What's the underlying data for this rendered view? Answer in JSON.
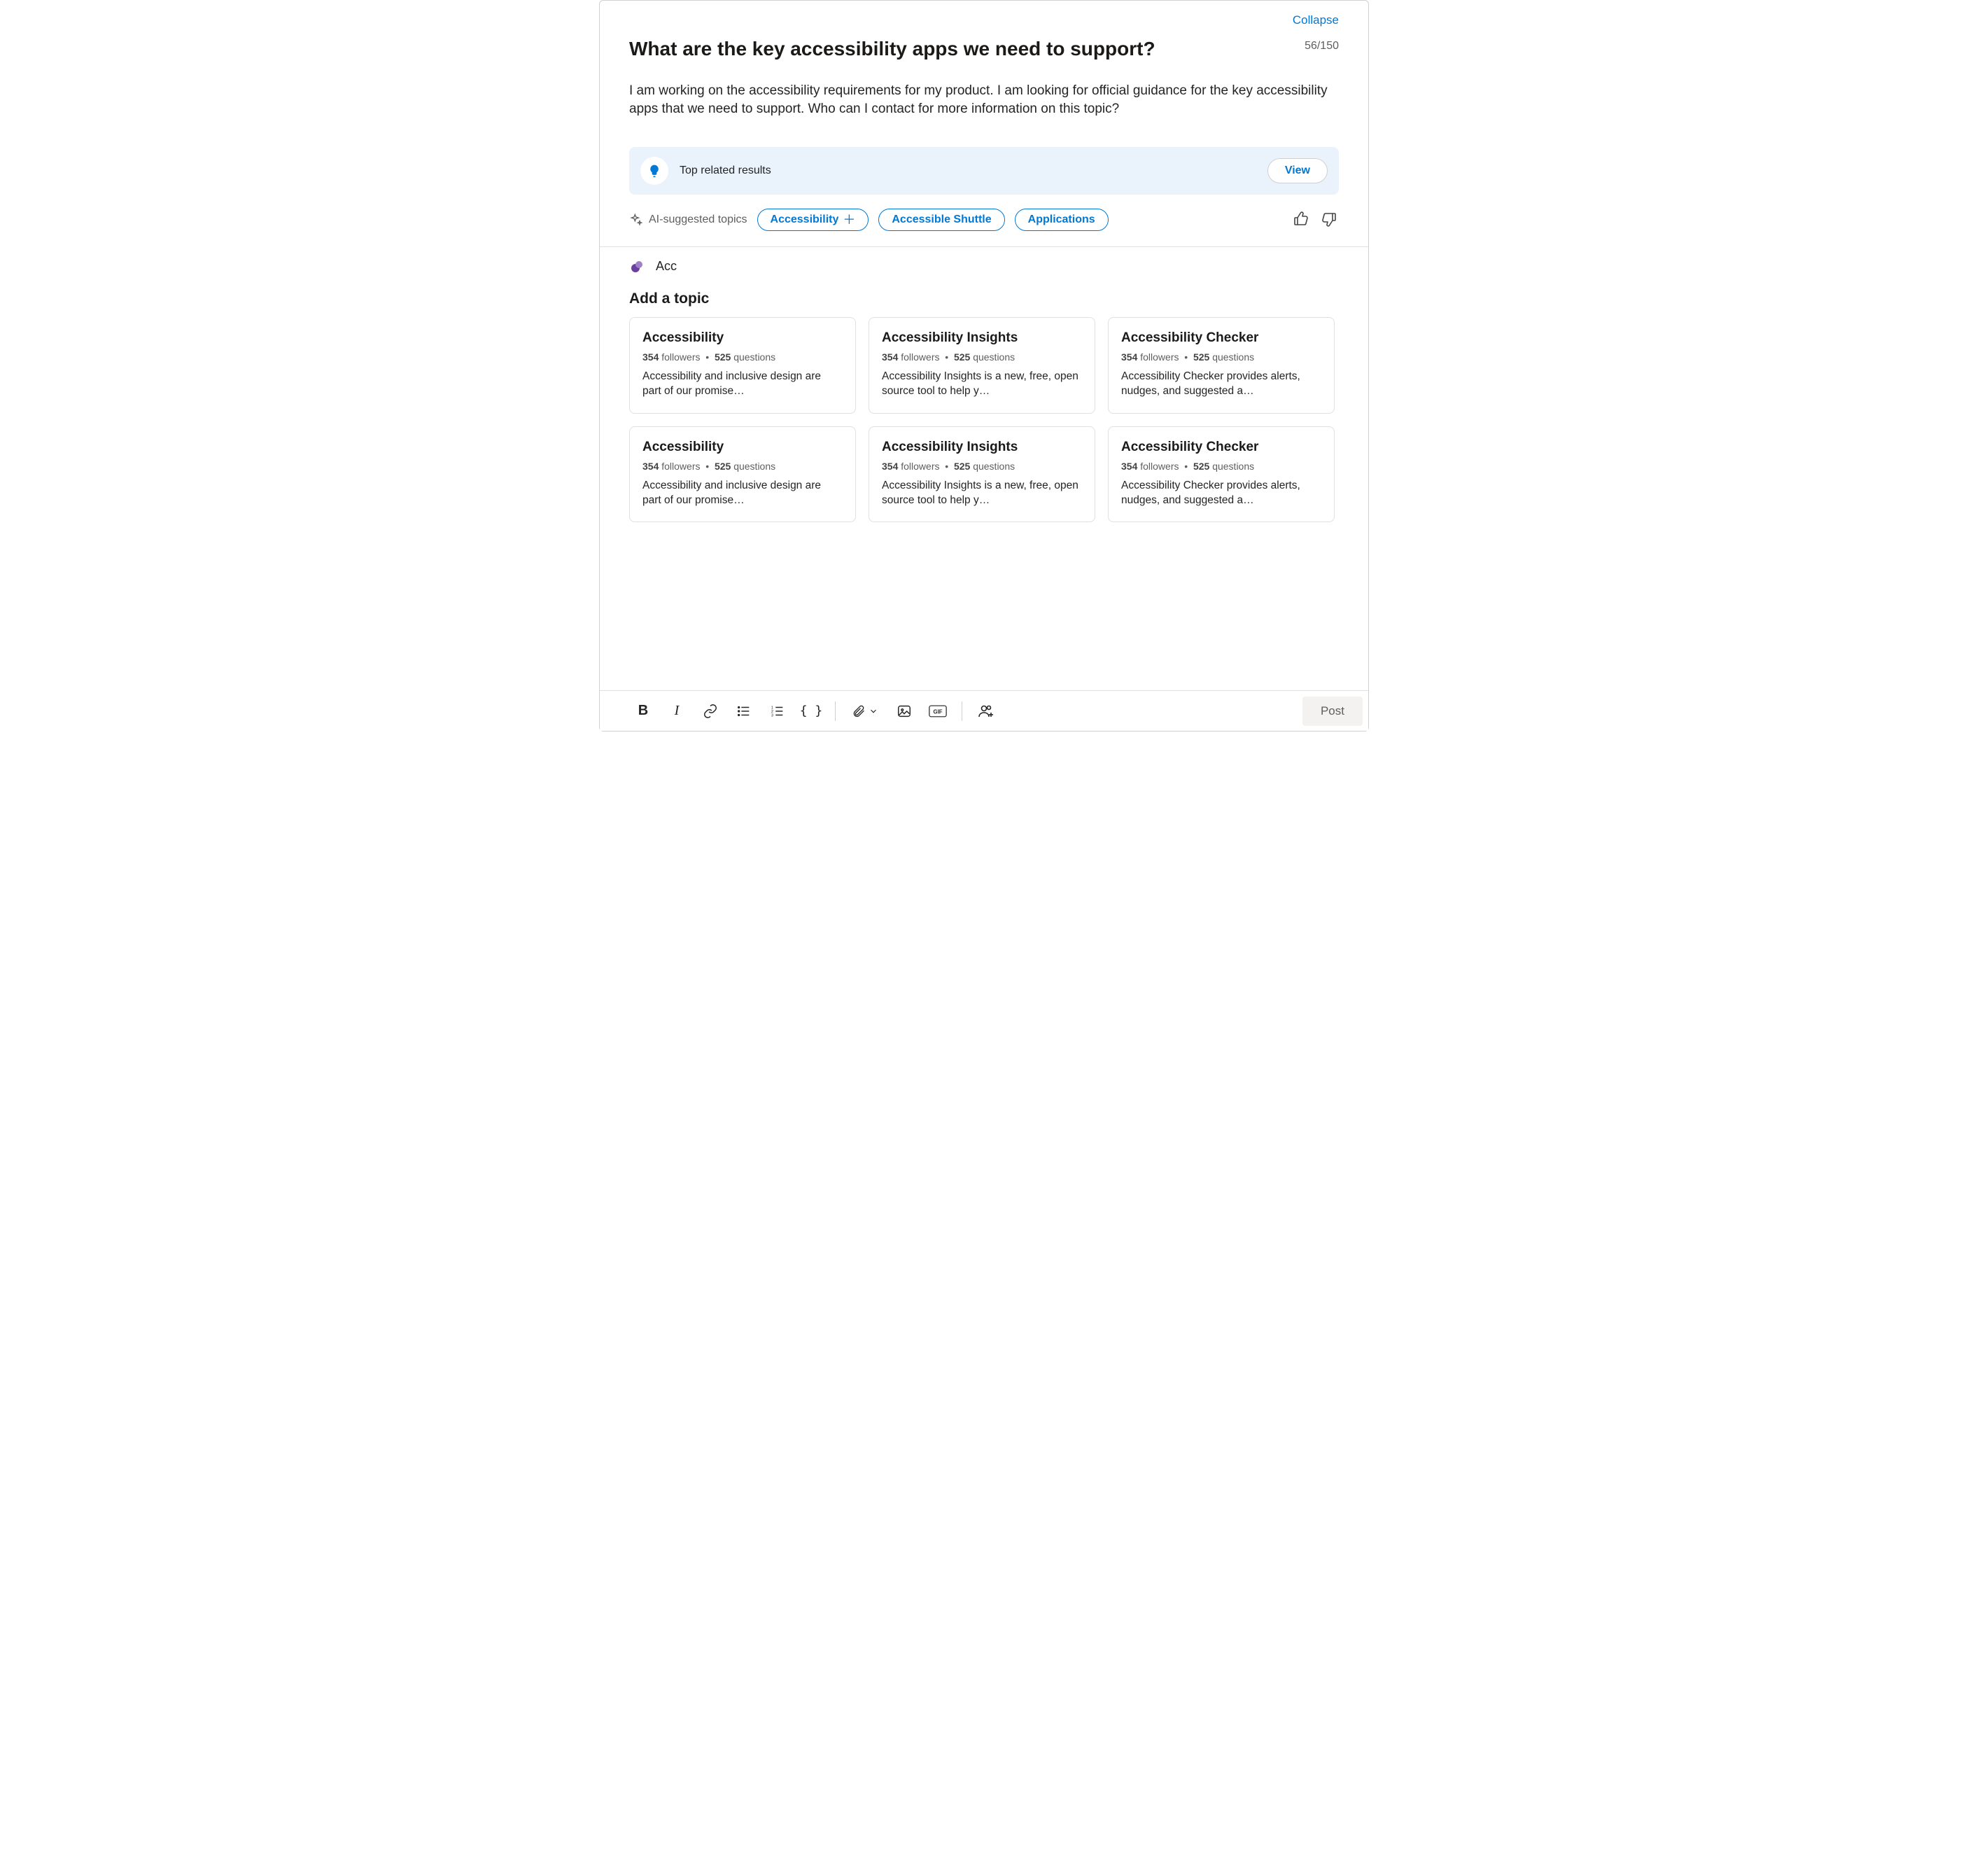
{
  "header": {
    "collapse": "Collapse",
    "title": "What are the key accessibility apps we need to support?",
    "counter": "56/150",
    "body": "I am working on the accessibility requirements for my product. I am looking for official guidance for the key accessibility apps that we need to support. Who can I contact for more information on this topic?"
  },
  "related": {
    "label": "Top related results",
    "view": "View"
  },
  "ai": {
    "label": "AI-suggested topics",
    "pills": [
      {
        "label": "Accessibility",
        "has_plus": true
      },
      {
        "label": "Accessible Shuttle",
        "has_plus": false
      },
      {
        "label": "Applications",
        "has_plus": false
      }
    ]
  },
  "topic_input": {
    "value": "Acc"
  },
  "add_topic_heading": "Add a topic",
  "cards": [
    {
      "title": "Accessibility",
      "followers": "354",
      "followers_label": "followers",
      "questions": "525",
      "questions_label": "questions",
      "desc": "Accessibility and inclusive design are part of our promise…"
    },
    {
      "title": "Accessibility Insights",
      "followers": "354",
      "followers_label": "followers",
      "questions": "525",
      "questions_label": "questions",
      "desc": "Accessibility Insights is a new, free, open source tool to help y…"
    },
    {
      "title": "Accessibility Checker",
      "followers": "354",
      "followers_label": "followers",
      "questions": "525",
      "questions_label": "questions",
      "desc": "Accessibility Checker provides alerts, nudges, and suggested a…"
    },
    {
      "title": "Accessibility",
      "followers": "354",
      "followers_label": "followers",
      "questions": "525",
      "questions_label": "questions",
      "desc": "Accessibility and inclusive design are part of our promise…"
    },
    {
      "title": "Accessibility Insights",
      "followers": "354",
      "followers_label": "followers",
      "questions": "525",
      "questions_label": "questions",
      "desc": "Accessibility Insights is a new, free, open source tool to help y…"
    },
    {
      "title": "Accessibility Checker",
      "followers": "354",
      "followers_label": "followers",
      "questions": "525",
      "questions_label": "questions",
      "desc": "Accessibility Checker provides alerts, nudges, and suggested a…"
    }
  ],
  "toolbar": {
    "post": "Post"
  }
}
